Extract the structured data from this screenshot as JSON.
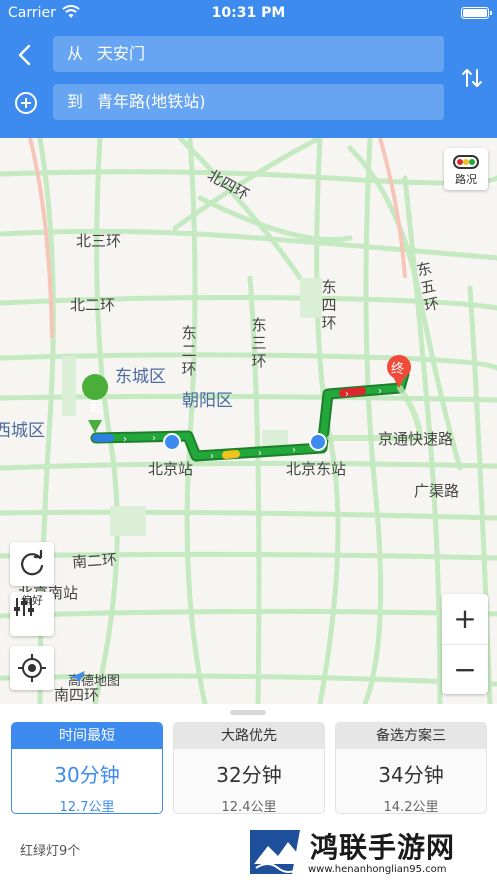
{
  "status_bar": {
    "carrier": "Carrier",
    "time": "10:31 PM"
  },
  "header": {
    "from_prefix": "从",
    "from_value": "天安门",
    "to_prefix": "到",
    "to_value": "青年路(地铁站)"
  },
  "map": {
    "traffic_label": "路况",
    "preference_label": "偏好",
    "logo_text": "高德地图",
    "start_marker": "起",
    "end_marker": "终",
    "labels": {
      "north_4th_ring": "北四环",
      "north_3rd_ring": "北三环",
      "north_2nd_ring": "北二环",
      "east_2nd_ring": "东二环",
      "east_3rd_ring": "东三环",
      "east_4th_ring": "东四环",
      "east_5th_ring": "东五环",
      "dongcheng": "东城区",
      "chaoyang": "朝阳区",
      "xicheng": "西城区",
      "beijing_station": "北京站",
      "beijing_east_station": "北京东站",
      "jingtong_expressway": "京通快速路",
      "guangqu_road": "广渠路",
      "south_2nd_ring": "南二环",
      "beijing_south_station": "北京南站",
      "south_4th_ring": "南四环"
    },
    "zoom_in": "+",
    "zoom_out": "−"
  },
  "routes": [
    {
      "title": "时间最短",
      "time": "30分钟",
      "distance": "12.7公里",
      "selected": true
    },
    {
      "title": "大路优先",
      "time": "32分钟",
      "distance": "12.4公里",
      "selected": false
    },
    {
      "title": "备选方案三",
      "time": "34分钟",
      "distance": "14.2公里",
      "selected": false
    }
  ],
  "traffic_lights": "红绿灯9个",
  "watermark": {
    "title": "鸿联手游网",
    "url": "www.henanhonglian95.com"
  },
  "colors": {
    "accent": "#3d8bef",
    "route_green": "#22a83a",
    "route_red": "#e0262d",
    "route_yellow": "#f2c21b",
    "road": "#b9e6b4",
    "start_marker": "#4aae3a",
    "end_marker": "#f04a3a"
  }
}
